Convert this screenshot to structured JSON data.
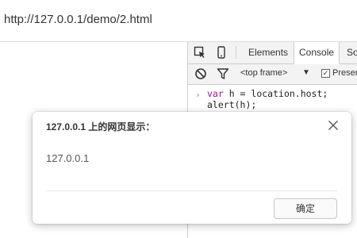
{
  "browser": {
    "url": "http://127.0.0.1/demo/2.html"
  },
  "devtools": {
    "tabs": [
      {
        "label": "Elements",
        "active": false
      },
      {
        "label": "Console",
        "active": true
      },
      {
        "label": "So",
        "active": false
      }
    ],
    "toolbar": {
      "context_label": "<top frame>",
      "dropdown_arrow": "▼",
      "preserve_log_label": "Preser",
      "preserve_log_checked": true
    },
    "console": {
      "prompt": "›",
      "lines": [
        {
          "keyword": "var",
          "rest": " h = location.host;"
        },
        {
          "keyword": "",
          "rest": "alert(h);"
        }
      ]
    },
    "icons": [
      "inspect-icon",
      "device-toggle-icon",
      "clear-console-icon",
      "filter-icon"
    ]
  },
  "dialog": {
    "title": "127.0.0.1 上的网页显示：",
    "message": "127.0.0.1",
    "ok_label": "确定",
    "close_icon": "close-icon"
  },
  "colors": {
    "keyword": "#aa0d91",
    "text": "#333333",
    "border": "#cccccc"
  }
}
